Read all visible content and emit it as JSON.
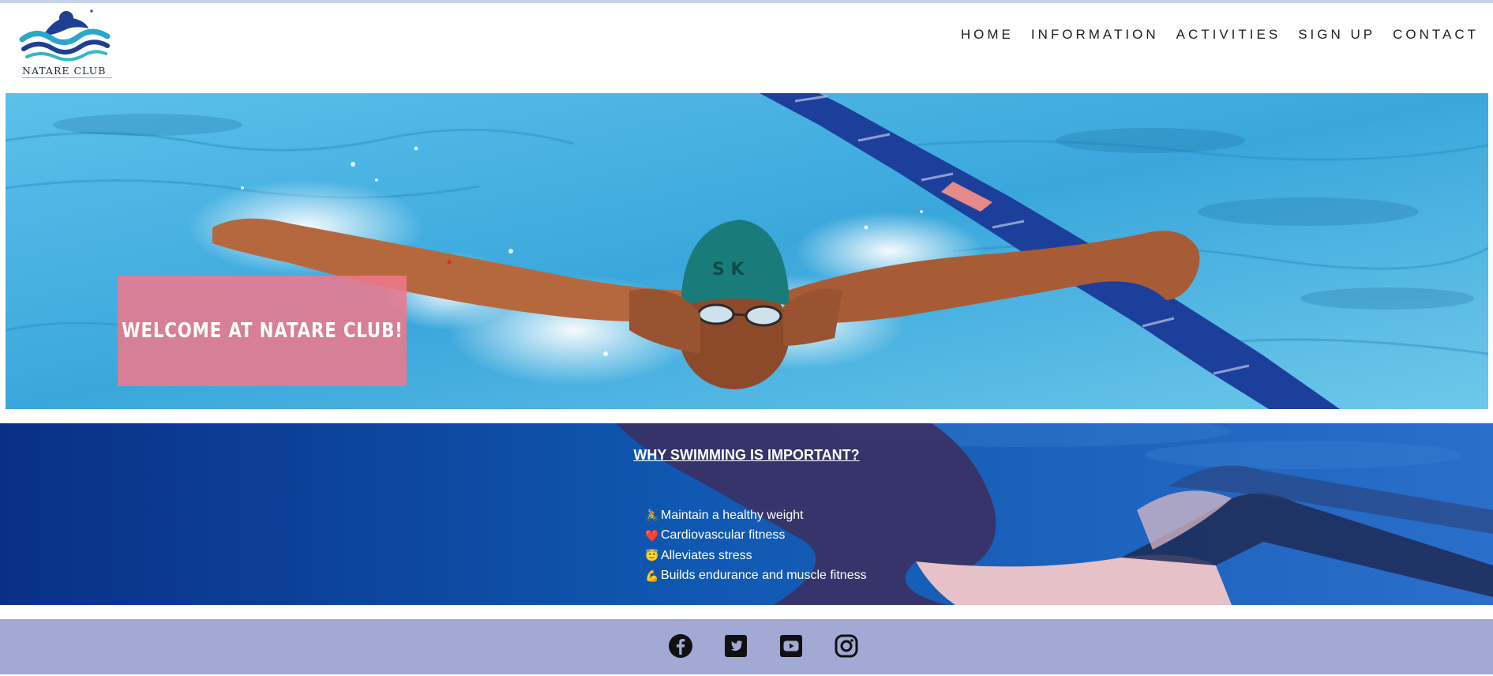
{
  "logo": {
    "text": "NATARE CLUB"
  },
  "nav": {
    "items": [
      {
        "label": "HOME"
      },
      {
        "label": "INFORMATION"
      },
      {
        "label": "ACTIVITIES"
      },
      {
        "label": "SIGN UP"
      },
      {
        "label": "CONTACT"
      }
    ]
  },
  "hero": {
    "welcome": "WELCOME AT NATARE CLUB!",
    "cap_text": "S K"
  },
  "why": {
    "title": "WHY SWIMMING IS IMPORTANT?",
    "items": [
      {
        "icon": "🚴",
        "text": "Maintain a healthy weight"
      },
      {
        "icon": "❤️",
        "text": "Cardiovascular fitness"
      },
      {
        "icon": "😇",
        "text": "Alleviates stress"
      },
      {
        "icon": "💪",
        "text": "Builds endurance and muscle fitness"
      }
    ]
  },
  "footer": {
    "social": [
      "facebook-icon",
      "twitter-icon",
      "youtube-icon",
      "instagram-icon"
    ]
  },
  "colors": {
    "welcome_box": "#f0788c",
    "footer_bg": "#a2a9d5",
    "why_bg": "#0b3e9a"
  }
}
